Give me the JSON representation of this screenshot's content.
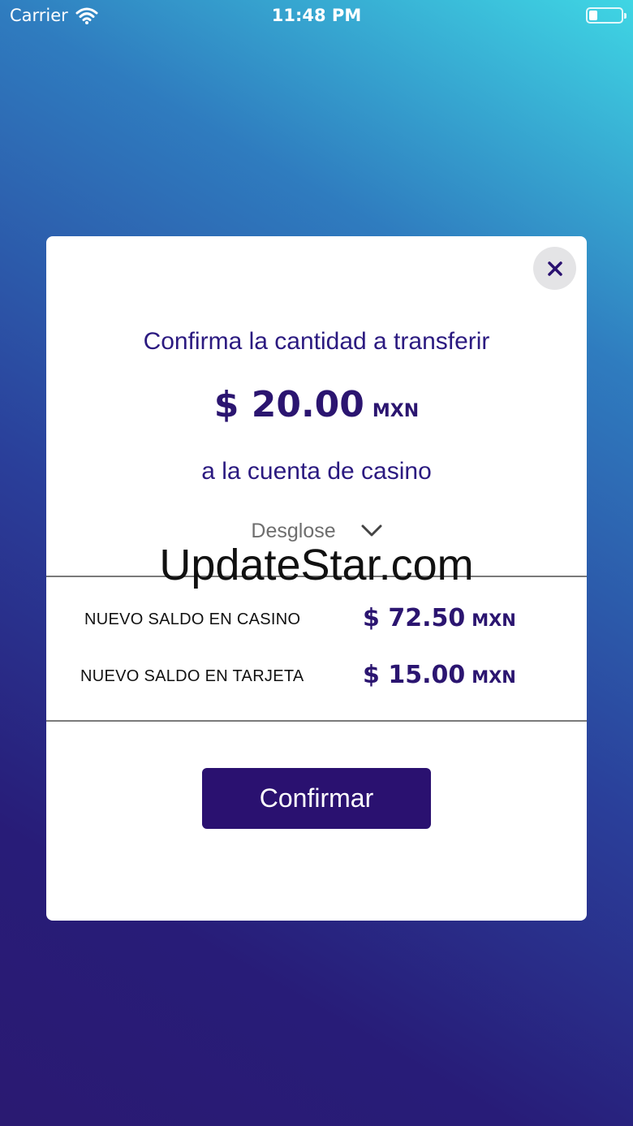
{
  "status_bar": {
    "carrier": "Carrier",
    "time": "11:48 PM",
    "battery_level": 0.25
  },
  "modal": {
    "title": "Confirma la cantidad a transferir",
    "amount": "$ 20.00",
    "amount_currency": "MXN",
    "subtitle": "a la cuenta de casino",
    "breakdown_label": "Desglose",
    "rows": [
      {
        "label": "NUEVO SALDO EN CASINO",
        "value": "$ 72.50",
        "currency": "MXN"
      },
      {
        "label": "NUEVO SALDO EN TARJETA",
        "value": "$ 15.00",
        "currency": "MXN"
      }
    ],
    "confirm_label": "Confirmar"
  },
  "watermark": "UpdateStar.com",
  "icons": {
    "close": "close-icon",
    "chevron": "chevron-down-icon",
    "wifi": "wifi-icon",
    "battery": "battery-icon"
  },
  "colors": {
    "primary": "#2a1170",
    "text_accent": "#2b1a80",
    "close_bg": "#e4e4e6"
  }
}
